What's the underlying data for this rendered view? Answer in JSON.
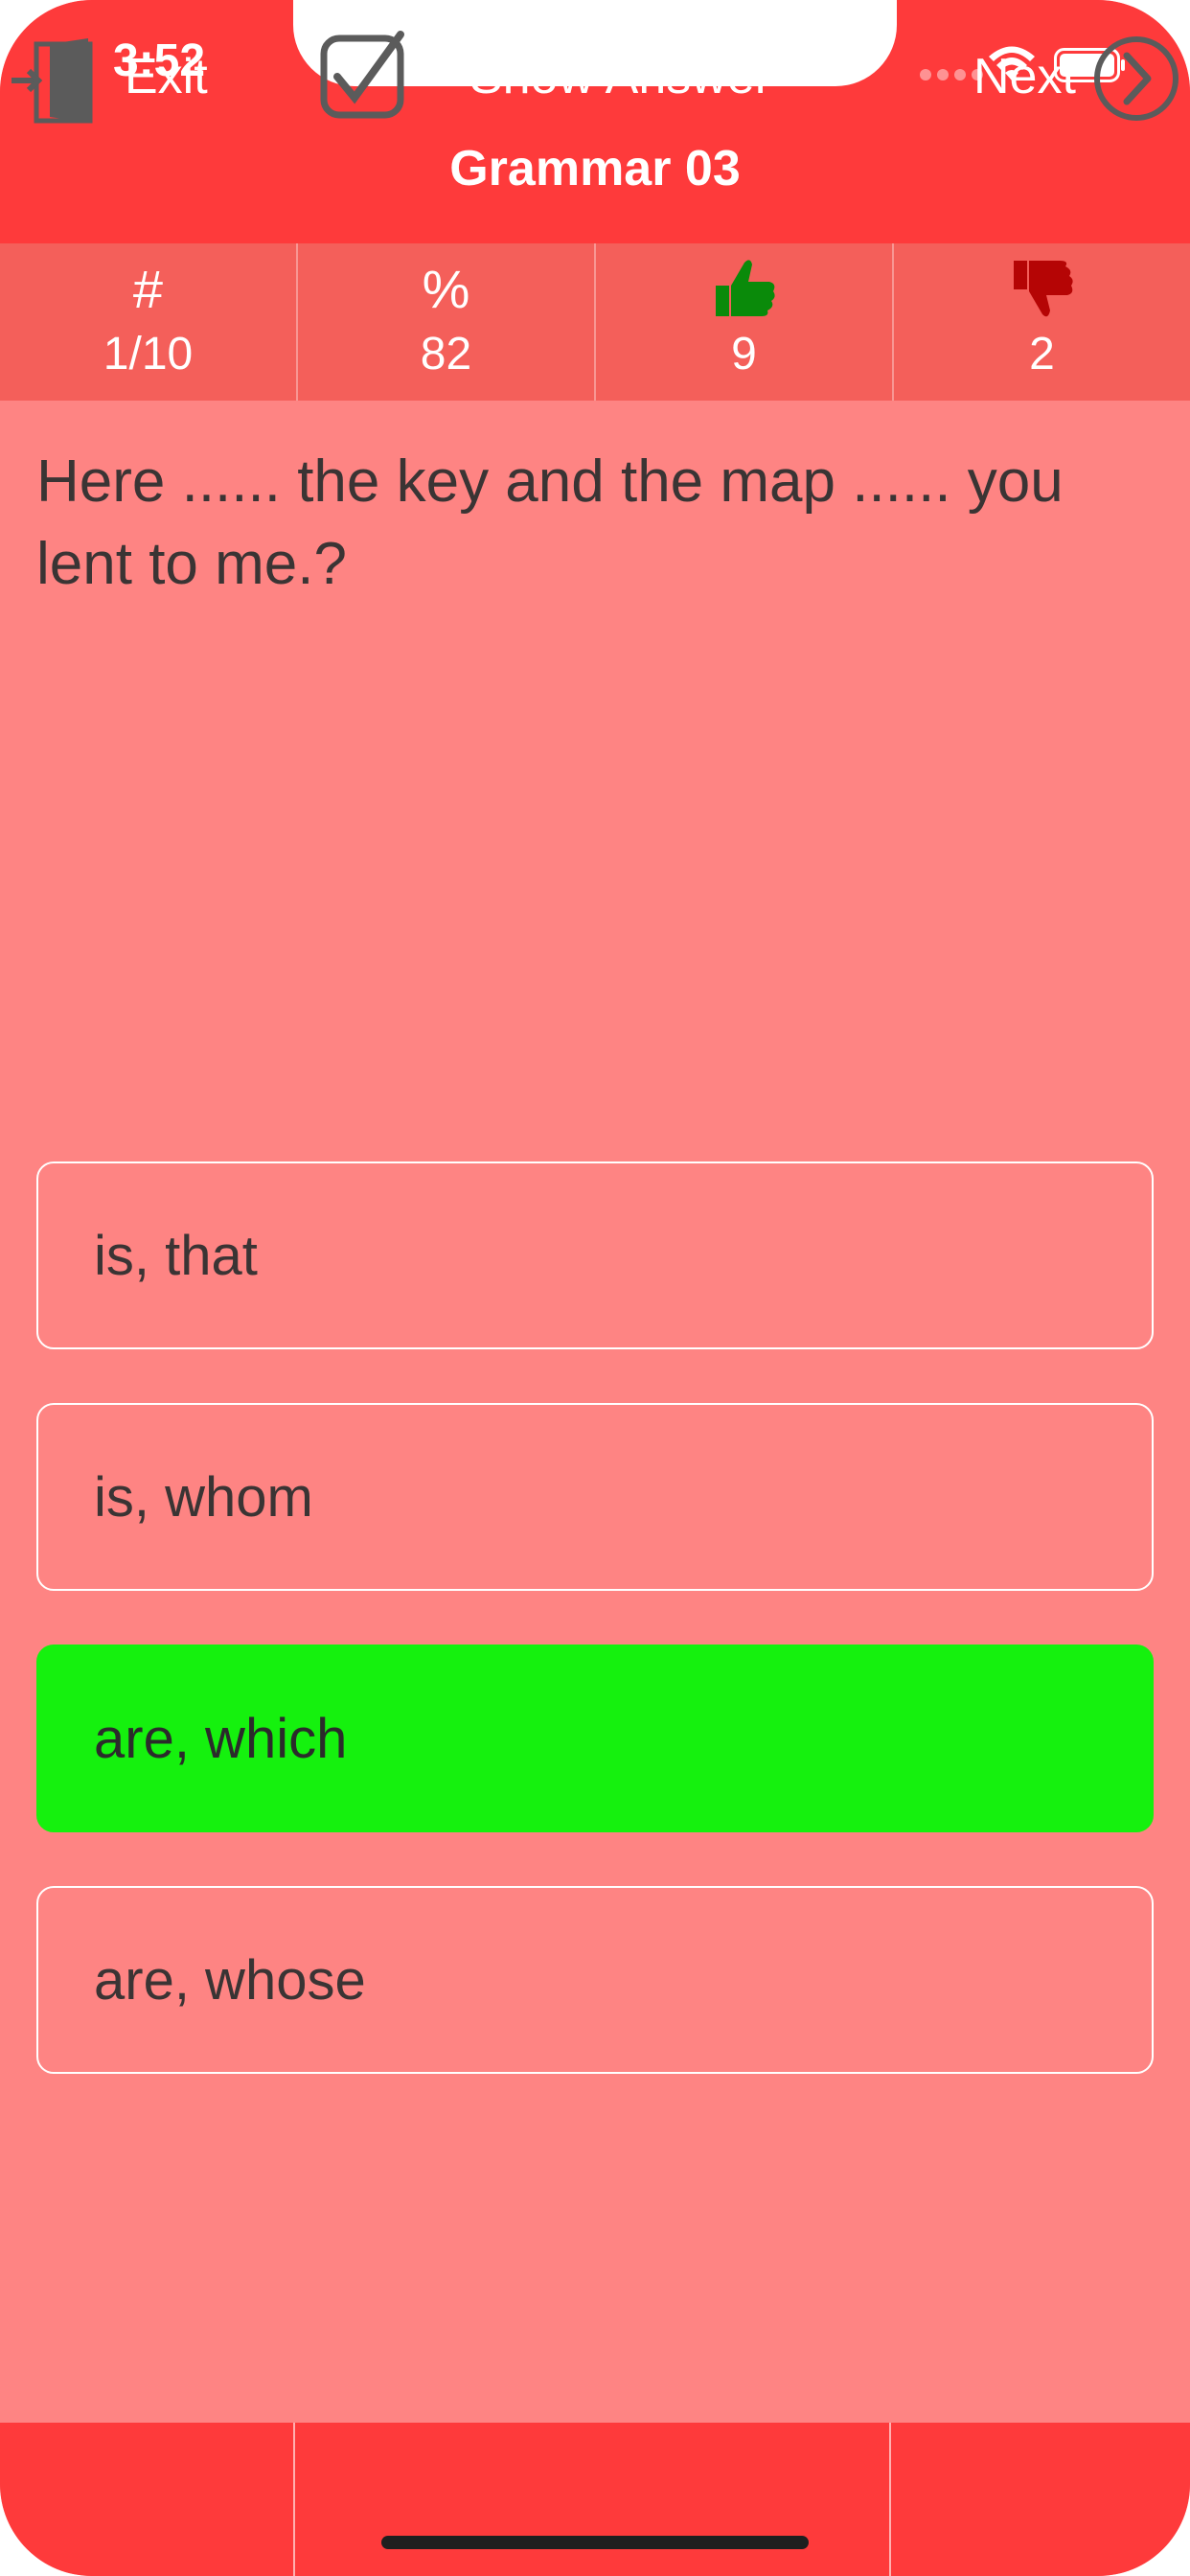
{
  "status_bar": {
    "time": "3:52",
    "icons": [
      "signal-dots-icon",
      "wifi-icon",
      "battery-icon"
    ]
  },
  "header": {
    "title": "Grammar 03"
  },
  "stats": {
    "question_icon": "#",
    "question_value": "1/10",
    "percent_icon": "%",
    "percent_value": "82",
    "correct_icon": "thumbs-up-icon",
    "correct_value": "9",
    "wrong_icon": "thumbs-down-icon",
    "wrong_value": "2"
  },
  "question": {
    "text": "Here ...... the key and the map ...... you lent to me.?"
  },
  "answers": [
    {
      "label": "is, that",
      "state": "normal"
    },
    {
      "label": "is, whom",
      "state": "normal"
    },
    {
      "label": "are, which",
      "state": "correct"
    },
    {
      "label": "are, whose",
      "state": "normal"
    }
  ],
  "toolbar": {
    "exit_label": "Exit",
    "show_answer_label": "Show Answer",
    "next_label": "Next"
  },
  "colors": {
    "header_red": "#fe3a3b",
    "stats_bg": "#f45f5a",
    "body_bg": "#fe8483",
    "correct_green": "#15f10e",
    "thumb_up": "#0a8a0a",
    "thumb_down": "#b50505",
    "toolbar_icon_gray": "#5b5b5b"
  }
}
